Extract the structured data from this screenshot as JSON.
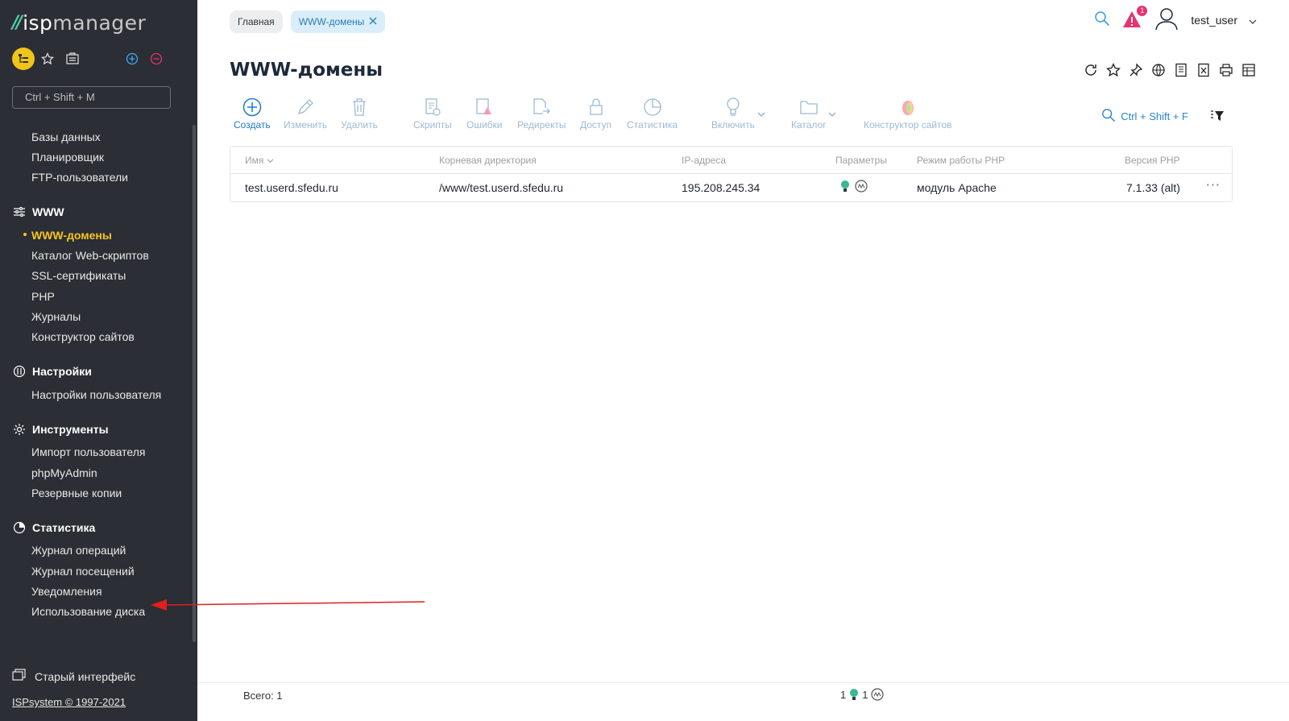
{
  "logo": {
    "mark": "//",
    "text_bold": "isp",
    "text_light": "manager"
  },
  "sidebar": {
    "search_placeholder": "Ctrl + Shift + M",
    "items_top": [
      "Базы данных",
      "Планировщик",
      "FTP-пользователи"
    ],
    "groups": {
      "www": {
        "label": "WWW",
        "items": [
          "WWW-домены",
          "Каталог Web-скриптов",
          "SSL-сертификаты",
          "PHP",
          "Журналы",
          "Конструктор сайтов"
        ]
      },
      "settings": {
        "label": "Настройки",
        "items": [
          "Настройки пользователя"
        ]
      },
      "tools": {
        "label": "Инструменты",
        "items": [
          "Импорт пользователя",
          "phpMyAdmin",
          "Резервные копии"
        ]
      },
      "stats": {
        "label": "Статистика",
        "items": [
          "Журнал операций",
          "Журнал посещений",
          "Уведомления",
          "Использование диска"
        ]
      }
    },
    "old_ui": "Старый интерфейс",
    "copyright": "ISPsystem © 1997-2021"
  },
  "breadcrumbs": [
    "Главная",
    "WWW-домены"
  ],
  "header": {
    "alert_count": "1",
    "user": "test_user"
  },
  "page_title": "WWW-домены",
  "toolbar": {
    "create": "Создать",
    "edit": "Изменить",
    "delete": "Удалить",
    "scripts": "Скрипты",
    "errors": "Ошибки",
    "redirects": "Редиректы",
    "access": "Доступ",
    "stats": "Статистика",
    "enable": "Включить",
    "catalog": "Каталог",
    "builder": "Конструктор сайтов",
    "search_hint": "Ctrl + Shift + F"
  },
  "table": {
    "columns": [
      "Имя",
      "Корневая директория",
      "IP-адреса",
      "Параметры",
      "Режим работы PHP",
      "Версия PHP"
    ],
    "rows": [
      {
        "name": "test.userd.sfedu.ru",
        "root": "/www/test.userd.sfedu.ru",
        "ip": "195.208.245.34",
        "php_mode": "модуль Apache",
        "php_version": "7.1.33 (alt)"
      }
    ]
  },
  "footer": {
    "total": "Всего: 1",
    "count_a": "1",
    "count_b": "1"
  },
  "colors": {
    "sidebar_bg": "#2b2e34",
    "accent_yellow": "#f7c51e",
    "link_blue": "#1f7ac4",
    "alert_pink": "#e8336f",
    "annotation_red": "#e0201c"
  }
}
